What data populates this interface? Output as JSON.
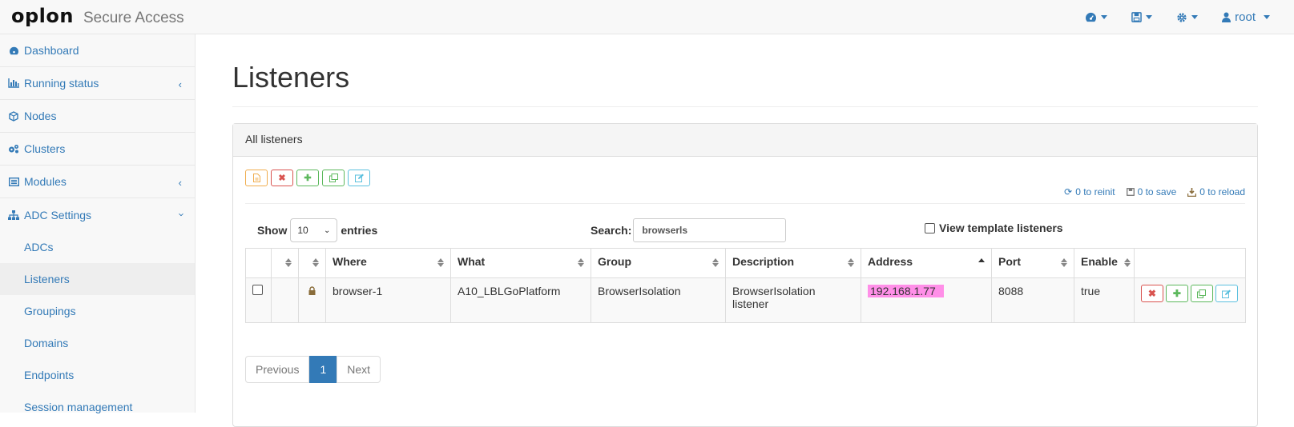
{
  "brand": {
    "logo": "oplon",
    "sub": "Secure Access"
  },
  "nav": {
    "user": "root"
  },
  "sidebar": {
    "items": [
      {
        "label": "Dashboard"
      },
      {
        "label": "Running status"
      },
      {
        "label": "Nodes"
      },
      {
        "label": "Clusters"
      },
      {
        "label": "Modules"
      },
      {
        "label": "ADC Settings"
      }
    ],
    "sub": [
      "ADCs",
      "Listeners",
      "Groupings",
      "Domains",
      "Endpoints",
      "Session management"
    ]
  },
  "page": {
    "title": "Listeners"
  },
  "panel": {
    "heading": "All listeners",
    "status": {
      "reinit": "0 to reinit",
      "save": "0 to save",
      "reload": "0 to reload"
    },
    "show_label": "Show",
    "show_value": "10",
    "entries_label": "entries",
    "search_label": "Search:",
    "search_value": "browserls",
    "template_label": "View template listeners"
  },
  "table": {
    "columns": [
      "Where",
      "What",
      "Group",
      "Description",
      "Address",
      "Port",
      "Enable"
    ],
    "rows": [
      {
        "where": "browser-1",
        "what": "A10_LBLGoPlatform",
        "group": "BrowserIsolation",
        "description": "BrowserIsolation listener",
        "address": "192.168.1.77",
        "port": "8088",
        "enable": "true"
      }
    ]
  },
  "pagination": {
    "previous": "Previous",
    "current": "1",
    "next": "Next"
  },
  "colors": {
    "link": "#337ab7",
    "highlight": "#ff8fe8",
    "accent": "#e8632c"
  }
}
